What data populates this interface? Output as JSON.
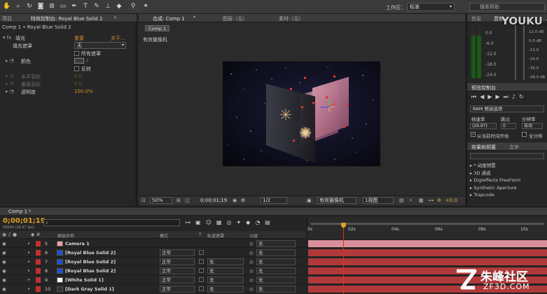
{
  "toolbar": {
    "tools": [
      "hand-tool-icon",
      "zoom-tool-icon",
      "rotate-tool-icon",
      "camera-tool-icon",
      "pan-behind-tool-icon",
      "mask-tool-icon",
      "pen-tool-icon",
      "type-tool-icon",
      "brush-tool-icon",
      "clone-tool-icon",
      "eraser-tool-icon",
      "roto-brush-tool-icon",
      "puppet-tool-icon"
    ],
    "workspace_label": "工作区：",
    "workspace_value": "标准",
    "help_search_placeholder": "搜索帮助"
  },
  "left_panel": {
    "tabs": [
      "项目",
      "特效控制台: Royal Blue Solid 2"
    ],
    "title": "Comp 1 • Royal Blue Solid 2",
    "effect_name": "填充",
    "reset_label": "重置",
    "about_label": "关于...",
    "fill_mask_label": "填充遮罩",
    "fill_mask_value": "无",
    "all_masks_label": "所有遮罩",
    "color_label": "颜色",
    "invert_label": "反转",
    "h_feather_label": "水平羽化",
    "h_feather_value": "0.0",
    "v_feather_label": "垂直羽化",
    "v_feather_value": "0.0",
    "opacity_label": "透明度",
    "opacity_value": "100.0%"
  },
  "comp_panel": {
    "tabs": [
      "合成: Comp 1",
      "图层: (无)",
      "素材: (无)"
    ],
    "comp_tab_chip": "Comp 1",
    "camera_label": "有效摄像机",
    "zoom_value": "50%",
    "timecode": "0;00;01;19",
    "resolution_value": "1/2",
    "camera_select": "有效摄像机",
    "views_select": "1视图",
    "exposure_value": "+0.0"
  },
  "right_panel": {
    "info_tabs": [
      "信息",
      "音频"
    ],
    "audio_db_left": [
      "0.0",
      "-6.0",
      "-12.0",
      "-18.0",
      "-24.0"
    ],
    "audio_db_right": [
      "12.0 dB",
      "0.0 dB",
      "-12.0",
      "-24.0",
      "-36.0",
      "-48.0 dB"
    ],
    "preview_tab": "预览控制台",
    "ram_preview_option": "RAM 预演选项",
    "frame_rate_label": "帧速率",
    "skip_label": "跳过",
    "resolution_label": "分辨率",
    "frame_rate_value": "(29.97)",
    "skip_value": "0",
    "resolution_value": "自动",
    "from_current_label": "从当前时间开始",
    "full_screen_label": "全分辨",
    "effects_tabs": [
      "效果和预置",
      "文字"
    ],
    "effects_items": [
      "* 动画预置",
      "3D 通道",
      "Digieffects FreeForm",
      "Synthetic Aperture",
      "Trapcode"
    ]
  },
  "timeline": {
    "tab": "Comp 1",
    "timecode": "0;00;01;19",
    "frames": "00049 (29.97 fps)",
    "search_placeholder": "",
    "col_source_name": "图层名称",
    "col_mode": "模式",
    "col_t": "T",
    "col_trkmat": "轨道遮罩",
    "col_parent": "父级",
    "ruler_ticks": [
      "0s",
      "02s",
      "04s",
      "06s",
      "08s",
      "10s"
    ],
    "layers": [
      {
        "num": "5",
        "name": "Camera 1",
        "mode": "",
        "trkmat": "",
        "parent": "无",
        "swatch": "#f0a0a8",
        "bar": "#d9909a",
        "icon": "camera-icon"
      },
      {
        "num": "6",
        "name": "[Royal Blue Solid 2]",
        "mode": "正常",
        "trkmat": "",
        "parent": "无",
        "swatch": "#1a4fd8",
        "bar": "#b03a3a",
        "icon": "solid-icon"
      },
      {
        "num": "7",
        "name": "[Royal Blue Solid 2]",
        "mode": "正常",
        "trkmat": "无",
        "parent": "无",
        "swatch": "#1a4fd8",
        "bar": "#b03a3a",
        "icon": "solid-icon"
      },
      {
        "num": "8",
        "name": "[Royal Blue Solid 2]",
        "mode": "正常",
        "trkmat": "无",
        "parent": "无",
        "swatch": "#1a4fd8",
        "bar": "#b03a3a",
        "icon": "solid-icon"
      },
      {
        "num": "9",
        "name": "[White Solid 1]",
        "mode": "正常",
        "trkmat": "无",
        "parent": "无",
        "swatch": "#ffffff",
        "bar": "#b03a3a",
        "icon": "solid-icon"
      },
      {
        "num": "10",
        "name": "[Dark Gray Solid 1]",
        "mode": "正常",
        "trkmat": "无",
        "parent": "无",
        "swatch": "#333333",
        "bar": "#b03a3a",
        "icon": "solid-icon"
      }
    ]
  },
  "watermarks": {
    "youku": "YOUKU 优酷",
    "zf_title": "朱峰社区",
    "zf_url": "ZF3D.COM"
  },
  "colors": {
    "accent_orange": "#d68a2c",
    "playhead": "#e0a020",
    "layer_bar_red": "#b03a3a",
    "layer_bar_pink": "#d9909a"
  }
}
